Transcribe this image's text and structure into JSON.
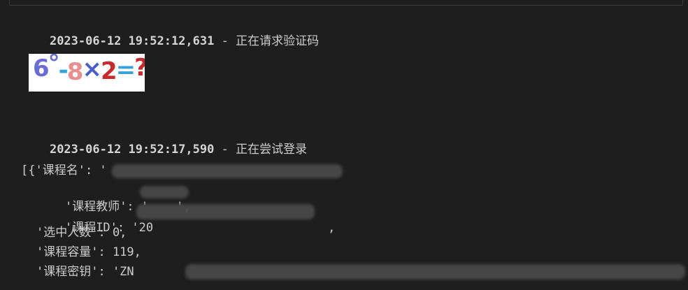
{
  "log": [
    {
      "timestamp": "2023-06-12 19:52:12,631",
      "separator": " - ",
      "message": "正在请求验证码"
    },
    {
      "timestamp": "2023-06-12 19:52:17,590",
      "separator": " - ",
      "message": "正在尝试登录"
    }
  ],
  "captcha": {
    "text": "6°-8×2=?",
    "char_colors": [
      "#6b6bd6",
      "#6b6bd6",
      "#3aa0d8",
      "#e88f8f",
      "#4a5ec8",
      "#c62a2a",
      "#3aa0d8",
      "#c62a2a"
    ]
  },
  "output": {
    "line1": "[{'课程名': '",
    "line2": "'课程教师': '",
    "line2_tail": "',",
    "line3": "'课程ID': '20",
    "line3_tail": ",",
    "line4": "'选中人数': 0,",
    "line5": "'课程容量': 119,",
    "line6": "'课程密钥': 'ZN"
  }
}
